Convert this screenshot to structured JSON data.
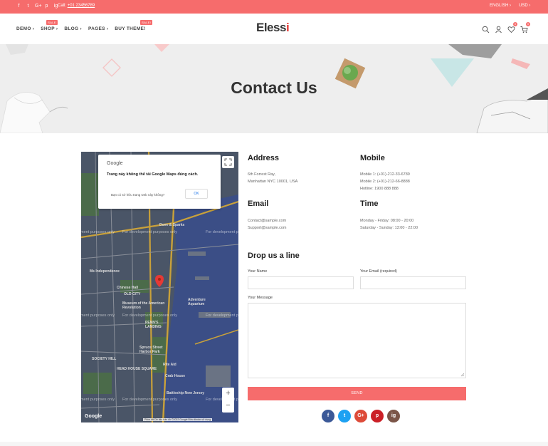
{
  "topbar": {
    "social_icons": [
      "f",
      "t",
      "G+",
      "p",
      "ig"
    ],
    "call_label": "Call:",
    "call_number": "+01 23456789",
    "language": "ENGLISH",
    "currency": "USD"
  },
  "header": {
    "nav": [
      {
        "label": "DEMO",
        "badge": ""
      },
      {
        "label": "SHOP",
        "badge": "SALE"
      },
      {
        "label": "BLOG",
        "badge": ""
      },
      {
        "label": "PAGES",
        "badge": ""
      },
      {
        "label": "BUY THEME!",
        "badge": "SALE!"
      }
    ],
    "logo_main": "Eless",
    "logo_accent": "i",
    "wishlist_count": "0",
    "cart_count": "0"
  },
  "banner": {
    "title": "Contact Us"
  },
  "map": {
    "dialog_logo": "Google",
    "dialog_title": "Trang này không thể tải Google Maps đúng cách.",
    "dialog_question": "Bạn có sở hữu trang web này không?",
    "dialog_ok": "OK",
    "watermark": "For development purposes only",
    "brand": "Google",
    "terms": "Phím tắt   Dữ liệu bản đồ ©2022 Google   Điều khoản sử dụng",
    "labels": [
      "Dove & Sparks",
      "Ms Independence",
      "Chinese Hall",
      "OLD CITY",
      "Museum of the American Revolution",
      "PENN'S LANDING",
      "SOCIETY HILL",
      "HEAD HOUSE SQUARE",
      "Battleship New Jersey",
      "Adventure Aquarium",
      "Spruce Street Harbor Park",
      "Rite Aid",
      "Crab House"
    ],
    "zoom_in": "+",
    "zoom_out": "−"
  },
  "contact": {
    "address_title": "Address",
    "address_lines": [
      "6th Forrest Ray,",
      "Manhattan NYC 10001, USA"
    ],
    "mobile_title": "Mobile",
    "mobile_lines": [
      "Mobile 1: (+01)-212-33-6789",
      "Mobile 2: (+01)-212-66-8888",
      "Hotline: 1900 888 888"
    ],
    "email_title": "Email",
    "email_lines": [
      "Contact@sample.com",
      "Support@sample.com"
    ],
    "time_title": "Time",
    "time_lines": [
      "Monday - Friday: 08:00 - 20:00",
      "Saturday - Sunday: 13:00 - 22:00"
    ]
  },
  "form": {
    "title": "Drop us a line",
    "name_label": "Your Name",
    "email_label": "Your Email (required)",
    "message_label": "Your Message",
    "send_label": "SEND"
  },
  "social_buttons": [
    {
      "icon": "f",
      "color": "#3b5998"
    },
    {
      "icon": "t",
      "color": "#1da1f2"
    },
    {
      "icon": "G+",
      "color": "#dd4b39"
    },
    {
      "icon": "p",
      "color": "#cb2027"
    },
    {
      "icon": "ig",
      "color": "#7b5548"
    }
  ],
  "colors": {
    "accent": "#f66c6c"
  }
}
